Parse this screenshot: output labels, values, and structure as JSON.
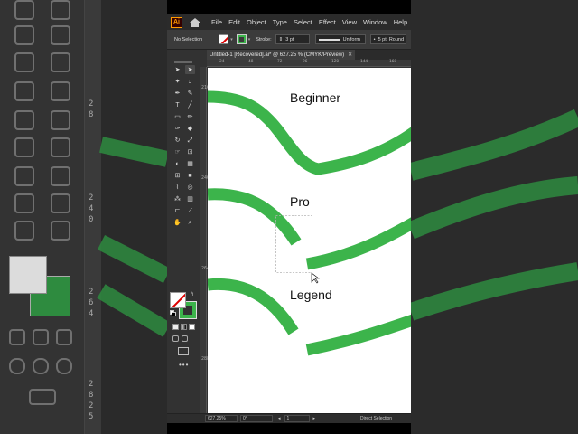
{
  "app": {
    "logo": "Ai",
    "menu": [
      "File",
      "Edit",
      "Object",
      "Type",
      "Select",
      "Effect",
      "View",
      "Window",
      "Help"
    ]
  },
  "control_bar": {
    "selection_label": "No Selection",
    "stroke_label": "Stroke:",
    "stroke_weight": "3 pt",
    "profile": "Uniform",
    "brush": "5 pt. Round"
  },
  "document": {
    "tab_title": "Untitled-1 [Recovered].ai* @ 627.25 % (CMYK/Preview)",
    "ruler_h_ticks": [
      "24",
      "48",
      "72",
      "96",
      "120",
      "144",
      "168"
    ],
    "ruler_v_ticks": [
      "216",
      "240",
      "264",
      "288"
    ]
  },
  "canvas": {
    "labels": {
      "beginner": "Beginner",
      "pro": "Pro",
      "legend": "Legend"
    },
    "stroke_color": "#3cb44b"
  },
  "status_bar": {
    "zoom": "627.25%",
    "rotation": "0°",
    "artboard": "1",
    "tool": "Direct Selection"
  },
  "background": {
    "ruler_ticks": [
      "2",
      "8",
      "2",
      "4",
      "0",
      "2",
      "6",
      "4",
      "2",
      "8",
      "2",
      "5"
    ]
  },
  "colors": {
    "accent_green": "#3cb44b",
    "ui_dark": "#323232",
    "menu_bg": "#2b2b2b"
  }
}
